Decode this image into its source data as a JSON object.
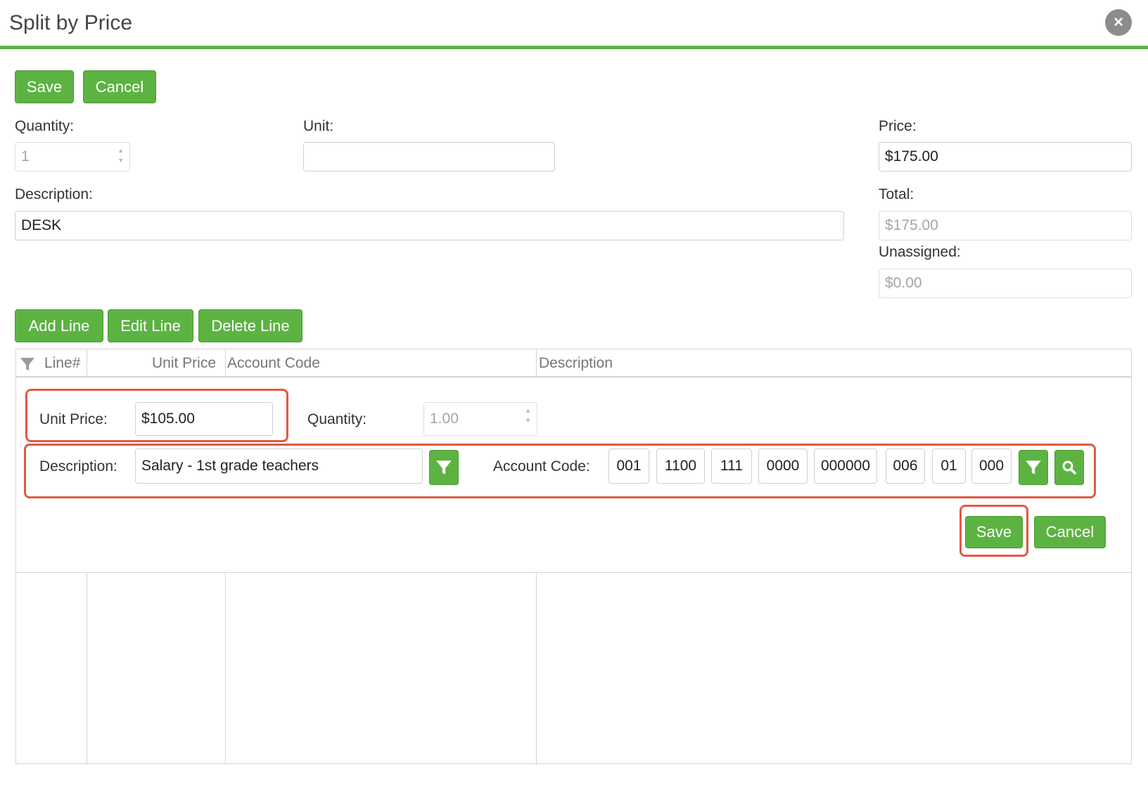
{
  "window": {
    "title": "Split by Price",
    "close_glyph": "×"
  },
  "toolbar": {
    "save_label": "Save",
    "cancel_label": "Cancel"
  },
  "form": {
    "quantity_label": "Quantity:",
    "quantity_value": "1",
    "unit_label": "Unit:",
    "unit_value": "",
    "price_label": "Price:",
    "price_value": "$175.00",
    "description_label": "Description:",
    "description_value": "DESK",
    "total_label": "Total:",
    "total_value": "$175.00",
    "unassigned_label": "Unassigned:",
    "unassigned_value": "$0.00"
  },
  "line_actions": {
    "add_label": "Add Line",
    "edit_label": "Edit Line",
    "delete_label": "Delete Line"
  },
  "grid": {
    "columns": [
      "Line#",
      "Unit Price",
      "Account Code",
      "Description"
    ]
  },
  "editor": {
    "unit_price_label": "Unit Price:",
    "unit_price_value": "$105.00",
    "quantity_label": "Quantity:",
    "quantity_value": "1.00",
    "description_label": "Description:",
    "description_value": "Salary - 1st grade teachers",
    "account_code_label": "Account Code:",
    "account_code_segments": [
      "001",
      "1100",
      "111",
      "0000",
      "000000",
      "006",
      "01",
      "000"
    ],
    "save_label": "Save",
    "cancel_label": "Cancel"
  },
  "icons": {
    "close": "close-icon",
    "filter": "filter-icon",
    "search": "search-icon"
  },
  "colors": {
    "accent": "#5cb342",
    "highlight": "#e05a45"
  }
}
